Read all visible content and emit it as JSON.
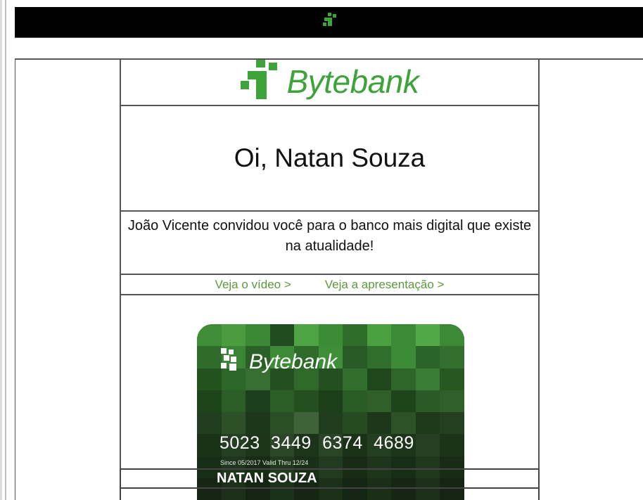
{
  "brand": {
    "name": "Bytebank",
    "accent": "#3ea33a"
  },
  "header": {
    "greeting": "Oi, Natan Souza"
  },
  "message": {
    "text": "João Vicente convidou você para o banco mais digital que existe na atualidade!"
  },
  "links": {
    "video": "Veja o vídeo >",
    "presentation": "Veja a apresentação >"
  },
  "card": {
    "brand": "Bytebank",
    "number": "5023 3449 6374 4689",
    "dates": "Since 05/2017  Valid Thru 12/24",
    "holder": "NATAN SOUZA"
  },
  "icons": [
    "bytebank-logo-icon"
  ]
}
